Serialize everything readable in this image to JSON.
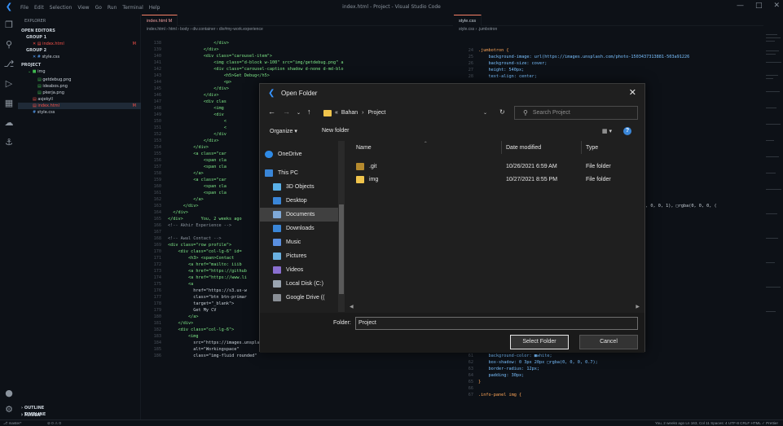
{
  "titlebar": {
    "menu": [
      "File",
      "Edit",
      "Selection",
      "View",
      "Go",
      "Run",
      "Terminal",
      "Help"
    ],
    "window_title": "index.html - Project - Visual Studio Code"
  },
  "sidebar": {
    "explorer_label": "EXPLORER",
    "open_editors": "OPEN EDITORS",
    "group1": "GROUP 1",
    "group1_file": "index.html",
    "group1_badge": "M",
    "group2": "GROUP 2",
    "group2_file": "style.css",
    "project": "PROJECT",
    "folder_img": "img",
    "files": [
      "getdebug.png",
      "ideabos.png",
      "pkerja.png"
    ],
    "folder_jekyll": "asjekyll",
    "index": "index.html",
    "index_badge": "M",
    "style": "style.css",
    "outline": "OUTLINE",
    "timeline": "TIMELINE",
    "maven": "MAVEN"
  },
  "editor_left": {
    "tab": "index.html M",
    "breadcrumb": "index.html › html › body › div.container › div#my-work.experience",
    "lines": [
      {
        "n": "138",
        "t": "                  </div>"
      },
      {
        "n": "139",
        "t": "              </div>"
      },
      {
        "n": "140",
        "t": "              <div class=\"carousel-item\">"
      },
      {
        "n": "141",
        "t": "                  <img class=\"d-block w-100\" src=\"img/getdebug.png\" a"
      },
      {
        "n": "142",
        "t": "                  <div class=\"carousel-caption shadow d-none d-md-blo"
      },
      {
        "n": "143",
        "t": "                      <h5>Get Debug</h5>"
      },
      {
        "n": "144",
        "t": "                      <p>"
      },
      {
        "n": "145",
        "t": "                  </div>"
      },
      {
        "n": "146",
        "t": "              </div>"
      },
      {
        "n": "147",
        "t": "              <div clas"
      },
      {
        "n": "148",
        "t": "                  <img"
      },
      {
        "n": "149",
        "t": "                  <div"
      },
      {
        "n": "150",
        "t": "                      <"
      },
      {
        "n": "151",
        "t": "                      <"
      },
      {
        "n": "152",
        "t": "                  </div"
      },
      {
        "n": "153",
        "t": "              </div>"
      },
      {
        "n": "154",
        "t": "          </div>"
      },
      {
        "n": "155",
        "t": "          <a class=\"car"
      },
      {
        "n": "156",
        "t": "              <span cla"
      },
      {
        "n": "157",
        "t": "              <span cla"
      },
      {
        "n": "158",
        "t": "          </a>"
      },
      {
        "n": "159",
        "t": "          <a class=\"car"
      },
      {
        "n": "160",
        "t": "              <span cla"
      },
      {
        "n": "161",
        "t": "              <span cla"
      },
      {
        "n": "162",
        "t": "          </a>"
      },
      {
        "n": "163",
        "t": "      </div>"
      },
      {
        "n": "164",
        "t": "  </div>"
      },
      {
        "n": "165",
        "t": "</div>       You, 2 weeks ago"
      },
      {
        "n": "166",
        "t": "<!-- Akhir Experience -->"
      },
      {
        "n": "167",
        "t": ""
      },
      {
        "n": "168",
        "t": "<!-- Awal Contact -->"
      },
      {
        "n": "169",
        "t": "<div class=\"row profile\">"
      },
      {
        "n": "170",
        "t": "    <div class=\"col-lg-6\" id="
      },
      {
        "n": "171",
        "t": "        <h3> <span>Contact"
      },
      {
        "n": "172",
        "t": "        <a href=\"mailto: iiib"
      },
      {
        "n": "173",
        "t": "        <a href=\"https://github"
      },
      {
        "n": "174",
        "t": "        <a href=\"https://www.li"
      },
      {
        "n": "175",
        "t": "        <a"
      },
      {
        "n": "176",
        "t": "          href=\"https://s3.us-w"
      },
      {
        "n": "177",
        "t": "          class=\"btn btn-primar"
      },
      {
        "n": "178",
        "t": "          target=\"_blank\">"
      },
      {
        "n": "179",
        "t": "          Get My CV"
      },
      {
        "n": "180",
        "t": "        </a>"
      },
      {
        "n": "181",
        "t": "    </div>"
      },
      {
        "n": "182",
        "t": "    <div class=\"col-lg-6\">"
      },
      {
        "n": "183",
        "t": "        <img"
      },
      {
        "n": "184",
        "t": "          src=\"https://images.unsplash.com/photo-1544502062-f82887f03d1c?ixi"
      },
      {
        "n": "185",
        "t": "          alt=\"Workingspace\""
      },
      {
        "n": "186",
        "t": "          class=\"img-fluid rounded\""
      }
    ]
  },
  "editor_right": {
    "tab": "style.css",
    "breadcrumb": "style.css › .jumbotron",
    "lines": [
      {
        "n": "24",
        "t": ".jumbotron {"
      },
      {
        "n": "25",
        "t": "    background-image: url(https://images.unsplash.com/photo-1503437313881-503a91226"
      },
      {
        "n": "26",
        "t": "    background-size: cover;"
      },
      {
        "n": "27",
        "t": "    height: 540px;"
      },
      {
        "n": "28",
        "t": "    text-align: center;"
      }
    ],
    "rgba_line": "0, 0, 0, 1), □rgba(0, 0, 0, (",
    "lines2": [
      {
        "n": "60",
        "t": ".info-panel {"
      },
      {
        "n": "61",
        "t": "    background-color: ■white;"
      },
      {
        "n": "62",
        "t": "    box-shadow: 0 3px 20px □rgba(0, 0, 0, 0.7);"
      },
      {
        "n": "63",
        "t": "    border-radius: 12px;"
      },
      {
        "n": "64",
        "t": "    padding: 30px;"
      },
      {
        "n": "65",
        "t": "}"
      },
      {
        "n": "66",
        "t": ""
      },
      {
        "n": "67",
        "t": ".info-panel img {"
      }
    ]
  },
  "status": {
    "branch": "master*",
    "sync": "⊘ 0 ⚠ 0",
    "right": "You, 2 weeks ago   Ln 163, Col 11   Spaces: 4   UTF-8   CRLF   HTML   ✓ Prettier"
  },
  "dialog": {
    "title": "Open Folder",
    "path": [
      "«",
      "Bahan",
      "Project"
    ],
    "search_placeholder": "Search Project",
    "organize": "Organize ▾",
    "new_folder": "New folder",
    "nav_items": [
      "OneDrive",
      "This PC",
      "3D Objects",
      "Desktop",
      "Documents",
      "Downloads",
      "Music",
      "Pictures",
      "Videos",
      "Local Disk (C:)",
      "Google Drive (("
    ],
    "nav_colors": [
      "#2e8ae6",
      "#3a86d8",
      "#5ab0e8",
      "#3a86d8",
      "#7fa9d8",
      "#3a86d8",
      "#5a8fe0",
      "#6ab0e0",
      "#8a6fd0",
      "#9aa4b0",
      "#8a8f96"
    ],
    "columns": {
      "name": "Name",
      "date": "Date modified",
      "type": "Type"
    },
    "files": [
      {
        "name": ".git",
        "date": "10/26/2021 6:59 AM",
        "type": "File folder"
      },
      {
        "name": "img",
        "date": "10/27/2021 8:55 PM",
        "type": "File folder"
      }
    ],
    "folder_label": "Folder:",
    "folder_value": "Project",
    "select_button": "Select Folder",
    "cancel_button": "Cancel"
  }
}
